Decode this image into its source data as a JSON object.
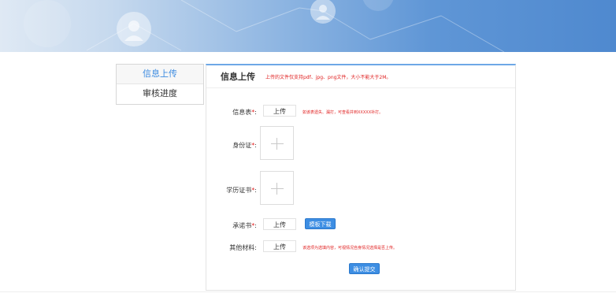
{
  "sidebar": {
    "items": [
      {
        "label": "信息上传",
        "active": true
      },
      {
        "label": "审核进度",
        "active": false
      }
    ]
  },
  "panel": {
    "title": "信息上传",
    "note": "上传的文件仅支持pdf、jpg、png文件，大小不能大于2M。"
  },
  "form": {
    "info_table": {
      "label": "信息表",
      "required_mark": "*",
      "colon": ":",
      "button": "上传",
      "hint": "如该表遗失、漏打，可查看并到XXXXX补打。"
    },
    "id_card": {
      "label": "身份证",
      "required_mark": "*",
      "colon": ":"
    },
    "diploma": {
      "label": "学历证书",
      "required_mark": "*",
      "colon": ":"
    },
    "commitment": {
      "label": "承诺书",
      "required_mark": "*",
      "colon": ":",
      "button": "上传",
      "template_button": "模板下载"
    },
    "other": {
      "label": "其他材料",
      "colon": ":",
      "button": "上传",
      "hint": "该选项为选填内容，可视情况自身情况选择是否上传。"
    },
    "submit": "确认提交"
  },
  "colors": {
    "accent": "#3d8ee3",
    "required": "#e02020",
    "banner_dark": "#4f89cf"
  }
}
